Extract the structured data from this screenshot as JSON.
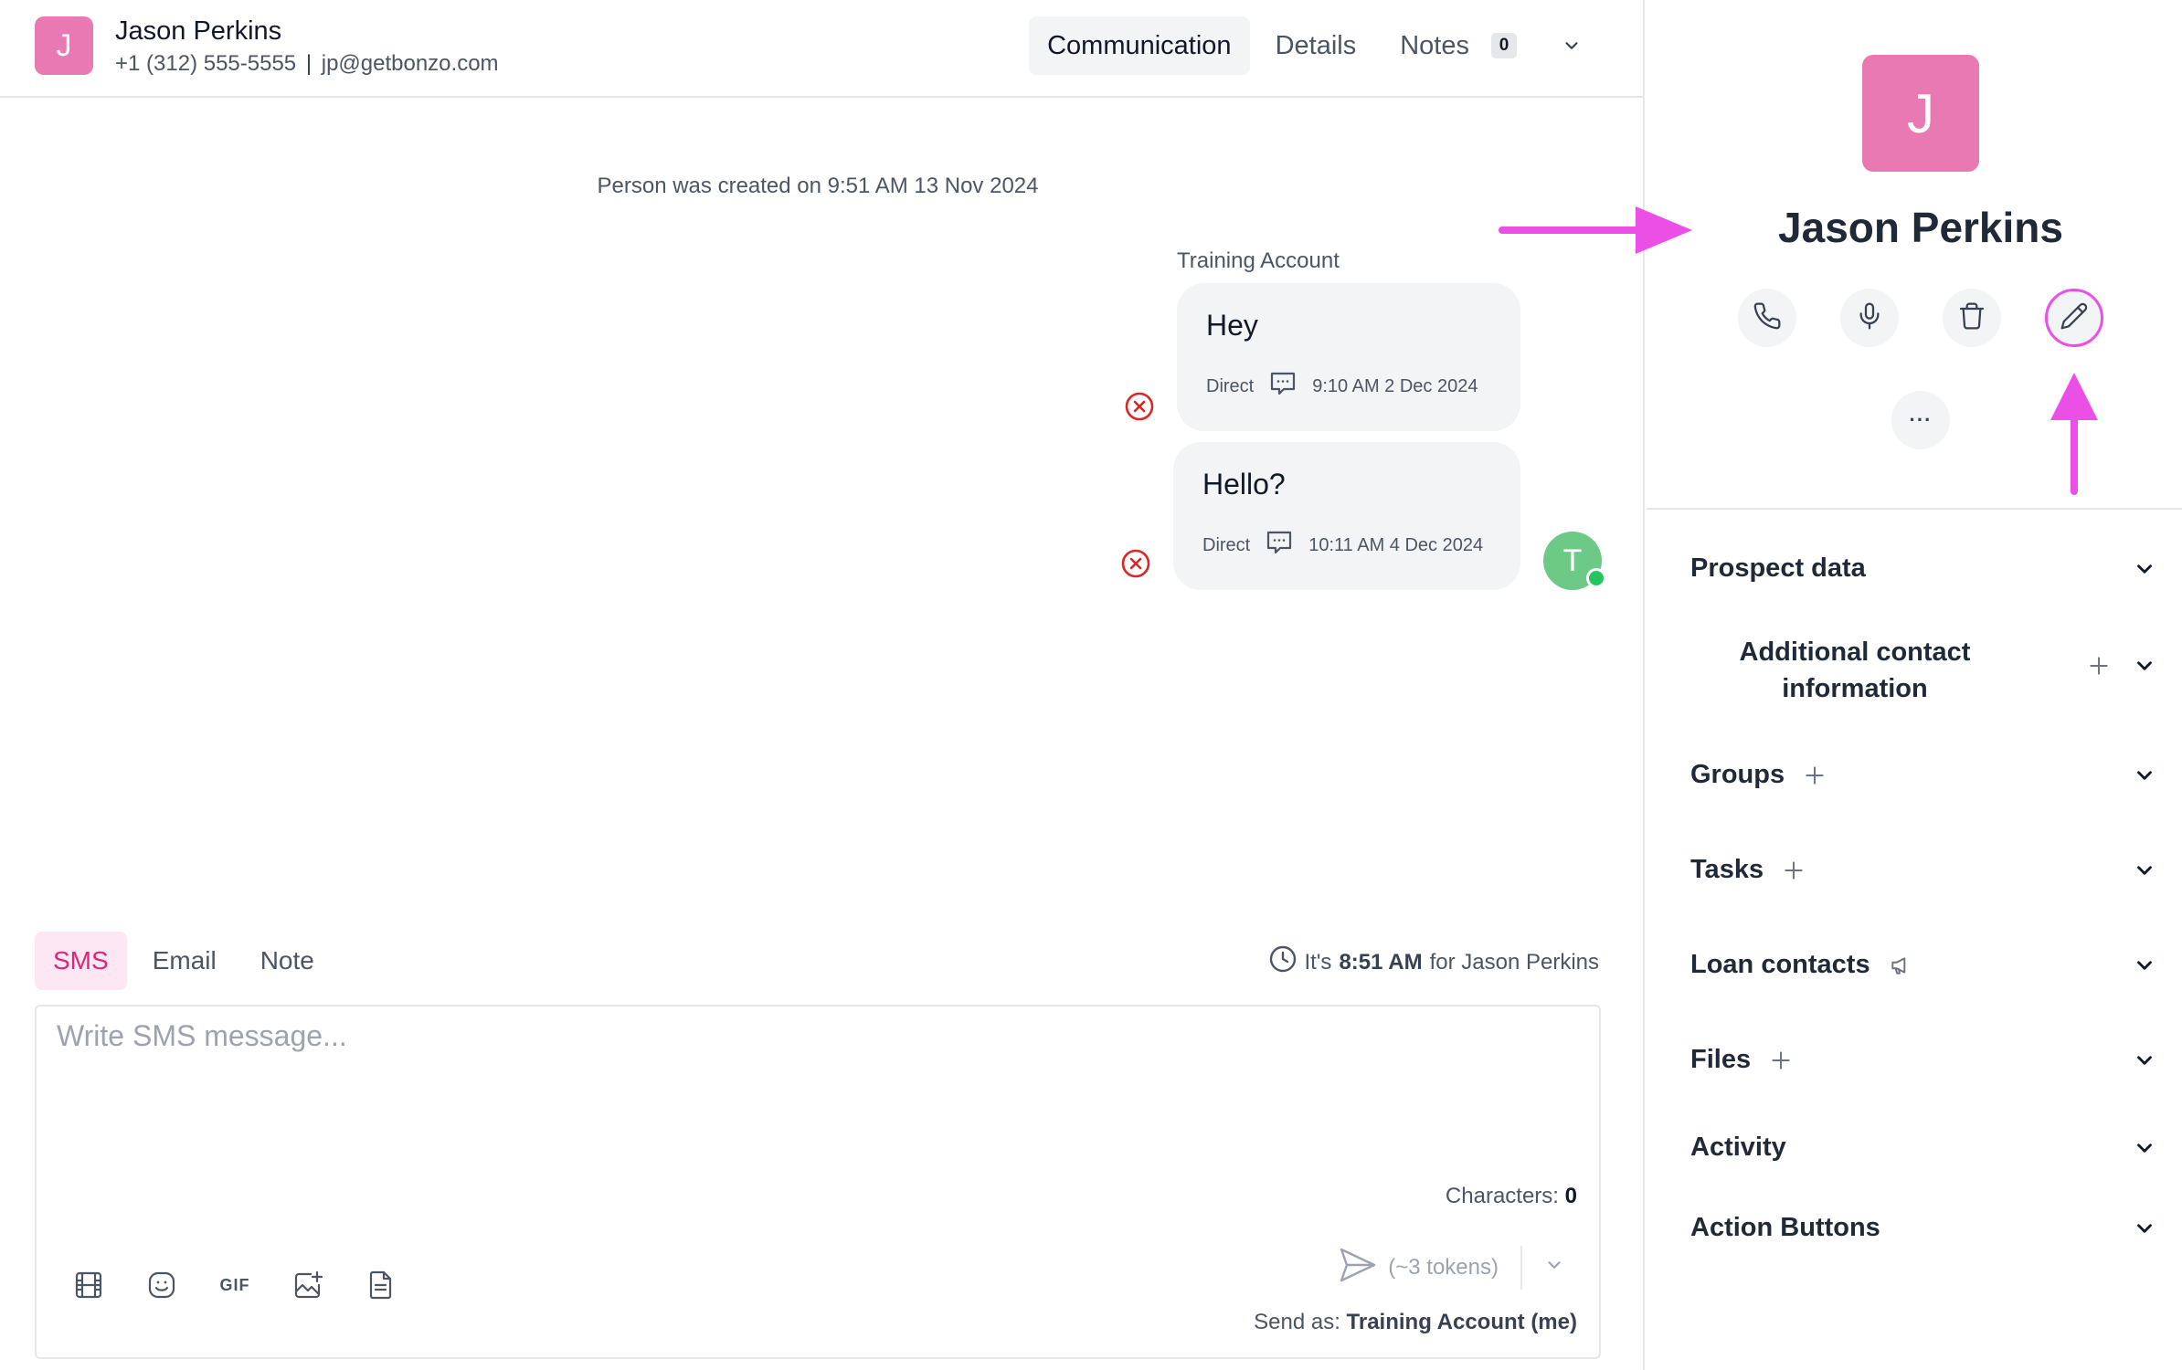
{
  "header": {
    "avatar_initial": "J",
    "name": "Jason Perkins",
    "phone": "+1 (312) 555-5555",
    "separator": "|",
    "email": "jp@getbonzo.com",
    "tabs": [
      {
        "label": "Communication",
        "active": true
      },
      {
        "label": "Details",
        "active": false
      },
      {
        "label": "Notes",
        "active": false
      }
    ],
    "notes_count": "0"
  },
  "timeline": {
    "created_text": "Person was created on 9:51 AM 13 Nov 2024",
    "sender_label": "Training Account",
    "messages": [
      {
        "text": "Hey",
        "channel": "Direct",
        "timestamp": "9:10 AM 2 Dec 2024",
        "status": "failed"
      },
      {
        "text": "Hello?",
        "channel": "Direct",
        "timestamp": "10:11 AM 4 Dec 2024",
        "status": "failed"
      }
    ],
    "agent_avatar_initial": "T"
  },
  "composer": {
    "tabs": [
      {
        "label": "SMS",
        "active": true
      },
      {
        "label": "Email",
        "active": false
      },
      {
        "label": "Note",
        "active": false
      }
    ],
    "local_time_prefix": "It's",
    "local_time": "8:51 AM",
    "local_time_suffix": "for Jason Perkins",
    "placeholder": "Write SMS message...",
    "characters_label": "Characters:",
    "characters_count": "0",
    "gif_label": "GIF",
    "tokens": "(~3 tokens)",
    "send_as_label": "Send as:",
    "send_as_value": "Training Account (me)"
  },
  "profile": {
    "avatar_initial": "J",
    "name": "Jason Perkins",
    "more_label": "···",
    "sections": {
      "prospect_data": "Prospect data",
      "additional_contact": [
        "Additional contact",
        "information"
      ],
      "groups": "Groups",
      "tasks": "Tasks",
      "loan_contacts": "Loan contacts",
      "files": "Files",
      "activity": "Activity",
      "action_buttons": "Action Buttons"
    }
  },
  "colors": {
    "accent_pink": "#e879b2",
    "annotation_magenta": "#ec4fe6",
    "error_red": "#dc2626",
    "agent_green": "#6cc986"
  }
}
